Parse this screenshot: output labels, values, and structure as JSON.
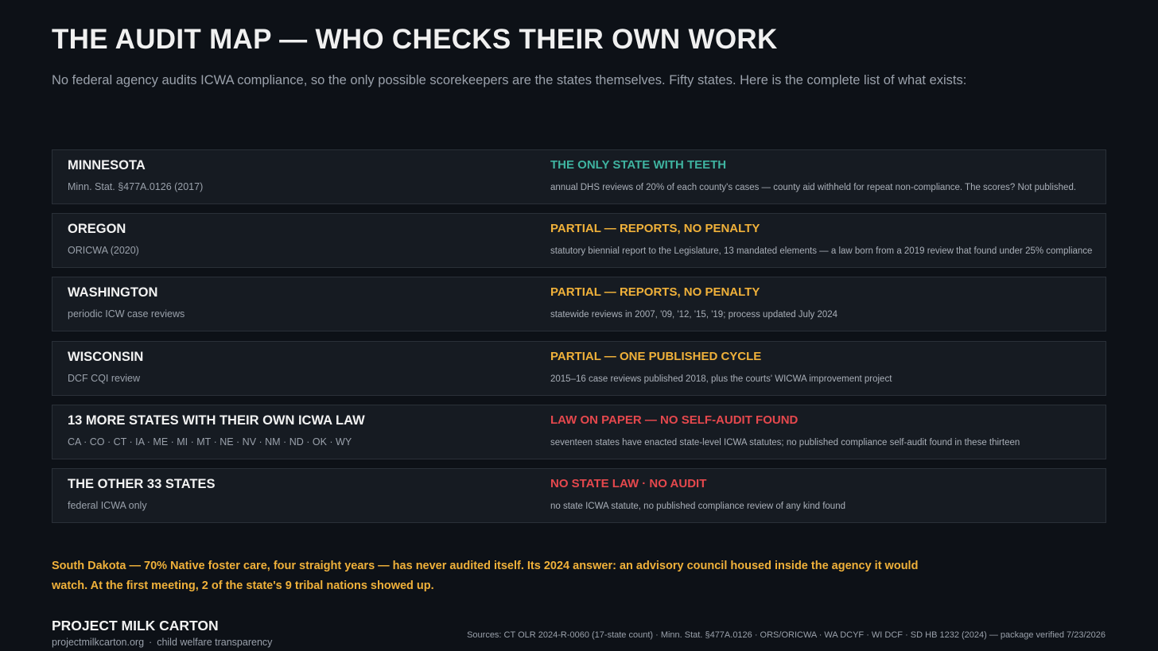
{
  "header": {
    "title": "THE AUDIT MAP — WHO CHECKS THEIR OWN WORK",
    "subtitle": "No federal agency audits ICWA compliance, so the only possible scorekeepers are the states themselves. Fifty states. Here is the complete list of what exists:"
  },
  "colors": {
    "teal": "#3fb3a0",
    "amber": "#f0b13a",
    "red": "#e5484d"
  },
  "rows": [
    {
      "name": "MINNESOTA",
      "detail": "Minn. Stat. §477A.0126 (2017)",
      "verdict": "THE ONLY STATE WITH TEETH",
      "status": "teal",
      "description": "annual DHS reviews of 20% of each county's cases — county aid withheld for repeat non-compliance. The scores? Not published."
    },
    {
      "name": "OREGON",
      "detail": "ORICWA (2020)",
      "verdict": "PARTIAL — REPORTS, NO PENALTY",
      "status": "amber",
      "description": "statutory biennial report to the Legislature, 13 mandated elements — a law born from a 2019 review that found under 25% compliance"
    },
    {
      "name": "WASHINGTON",
      "detail": "periodic ICW case reviews",
      "verdict": "PARTIAL — REPORTS, NO PENALTY",
      "status": "amber",
      "description": "statewide reviews in 2007, '09, '12, '15, '19; process updated July 2024"
    },
    {
      "name": "WISCONSIN",
      "detail": "DCF CQI review",
      "verdict": "PARTIAL — ONE PUBLISHED CYCLE",
      "status": "amber",
      "description": "2015–16 case reviews published 2018, plus the courts' WICWA improvement project"
    },
    {
      "name": "13 MORE STATES WITH THEIR OWN ICWA LAW",
      "detail": "CA · CO · CT · IA · ME · MI · MT · NE · NV · NM · ND · OK · WY",
      "verdict": "LAW ON PAPER — NO SELF-AUDIT FOUND",
      "status": "red",
      "description": "seventeen states have enacted state-level ICWA statutes; no published compliance self-audit found in these thirteen"
    },
    {
      "name": "THE OTHER 33 STATES",
      "detail": "federal ICWA only",
      "verdict": "NO STATE LAW · NO AUDIT",
      "status": "red",
      "description": "no state ICWA statute, no published compliance review of any kind found"
    }
  ],
  "callout": "South Dakota — 70% Native foster care, four straight years — has never audited itself. Its 2024 answer: an advisory council housed inside the agency it would watch. At the first meeting, 2 of the state's 9 tribal nations showed up.",
  "footer": {
    "brand": "PROJECT MILK CARTON",
    "url": "projectmilkcarton.org",
    "separator": "·",
    "tagline": "child welfare transparency",
    "sources": "Sources: CT OLR 2024-R-0060 (17-state count) · Minn. Stat. §477A.0126 · ORS/ORICWA · WA DCYF · WI DCF · SD HB 1232 (2024) — package verified 7/23/2026"
  }
}
